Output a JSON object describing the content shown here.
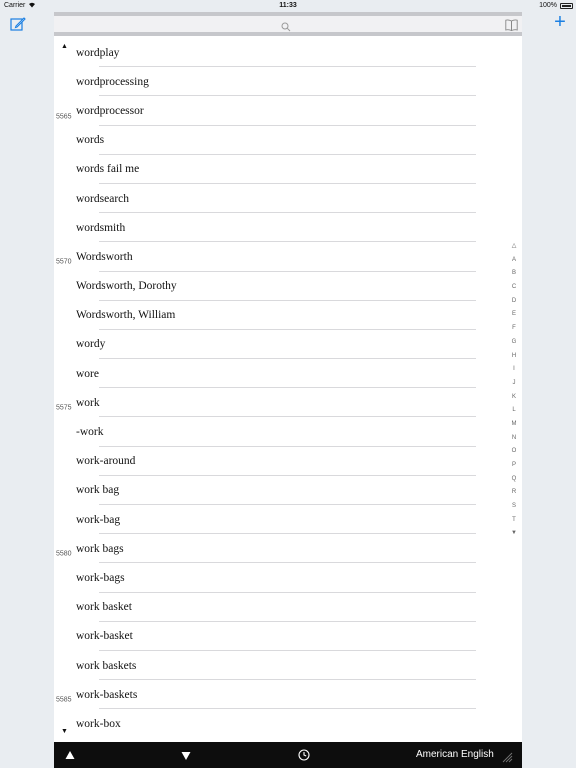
{
  "status_bar": {
    "carrier": "Carrier",
    "time": "11:33",
    "battery": "100%"
  },
  "toolbar": {
    "edit_icon": "compose-icon",
    "add_label": "+"
  },
  "search": {
    "icon": "search-icon",
    "bookmark_icon": "book-icon"
  },
  "list": {
    "scroll_up": "▲",
    "scroll_down": "▼",
    "items": [
      {
        "num": "",
        "word": "wordplay"
      },
      {
        "num": "",
        "word": "wordprocessing"
      },
      {
        "num": "5565",
        "word": "wordprocessor"
      },
      {
        "num": "",
        "word": "words"
      },
      {
        "num": "",
        "word": "words fail me"
      },
      {
        "num": "",
        "word": "wordsearch"
      },
      {
        "num": "",
        "word": "wordsmith"
      },
      {
        "num": "5570",
        "word": "Wordsworth"
      },
      {
        "num": "",
        "word": "Wordsworth, Dorothy"
      },
      {
        "num": "",
        "word": "Wordsworth, William"
      },
      {
        "num": "",
        "word": "wordy"
      },
      {
        "num": "",
        "word": "wore"
      },
      {
        "num": "5575",
        "word": "work"
      },
      {
        "num": "",
        "word": "-work"
      },
      {
        "num": "",
        "word": "work-around"
      },
      {
        "num": "",
        "word": "work bag"
      },
      {
        "num": "",
        "word": "work-bag"
      },
      {
        "num": "5580",
        "word": "work bags"
      },
      {
        "num": "",
        "word": "work-bags"
      },
      {
        "num": "",
        "word": "work basket"
      },
      {
        "num": "",
        "word": "work-basket"
      },
      {
        "num": "",
        "word": "work baskets"
      },
      {
        "num": "5585",
        "word": "work-baskets"
      },
      {
        "num": "",
        "word": "work-box"
      }
    ]
  },
  "alpha_index": [
    "△",
    "A",
    "B",
    "C",
    "D",
    "E",
    "F",
    "G",
    "H",
    "I",
    "J",
    "K",
    "L",
    "M",
    "N",
    "O",
    "P",
    "Q",
    "R",
    "S",
    "T",
    "▼"
  ],
  "bottom_bar": {
    "language": "American English"
  }
}
